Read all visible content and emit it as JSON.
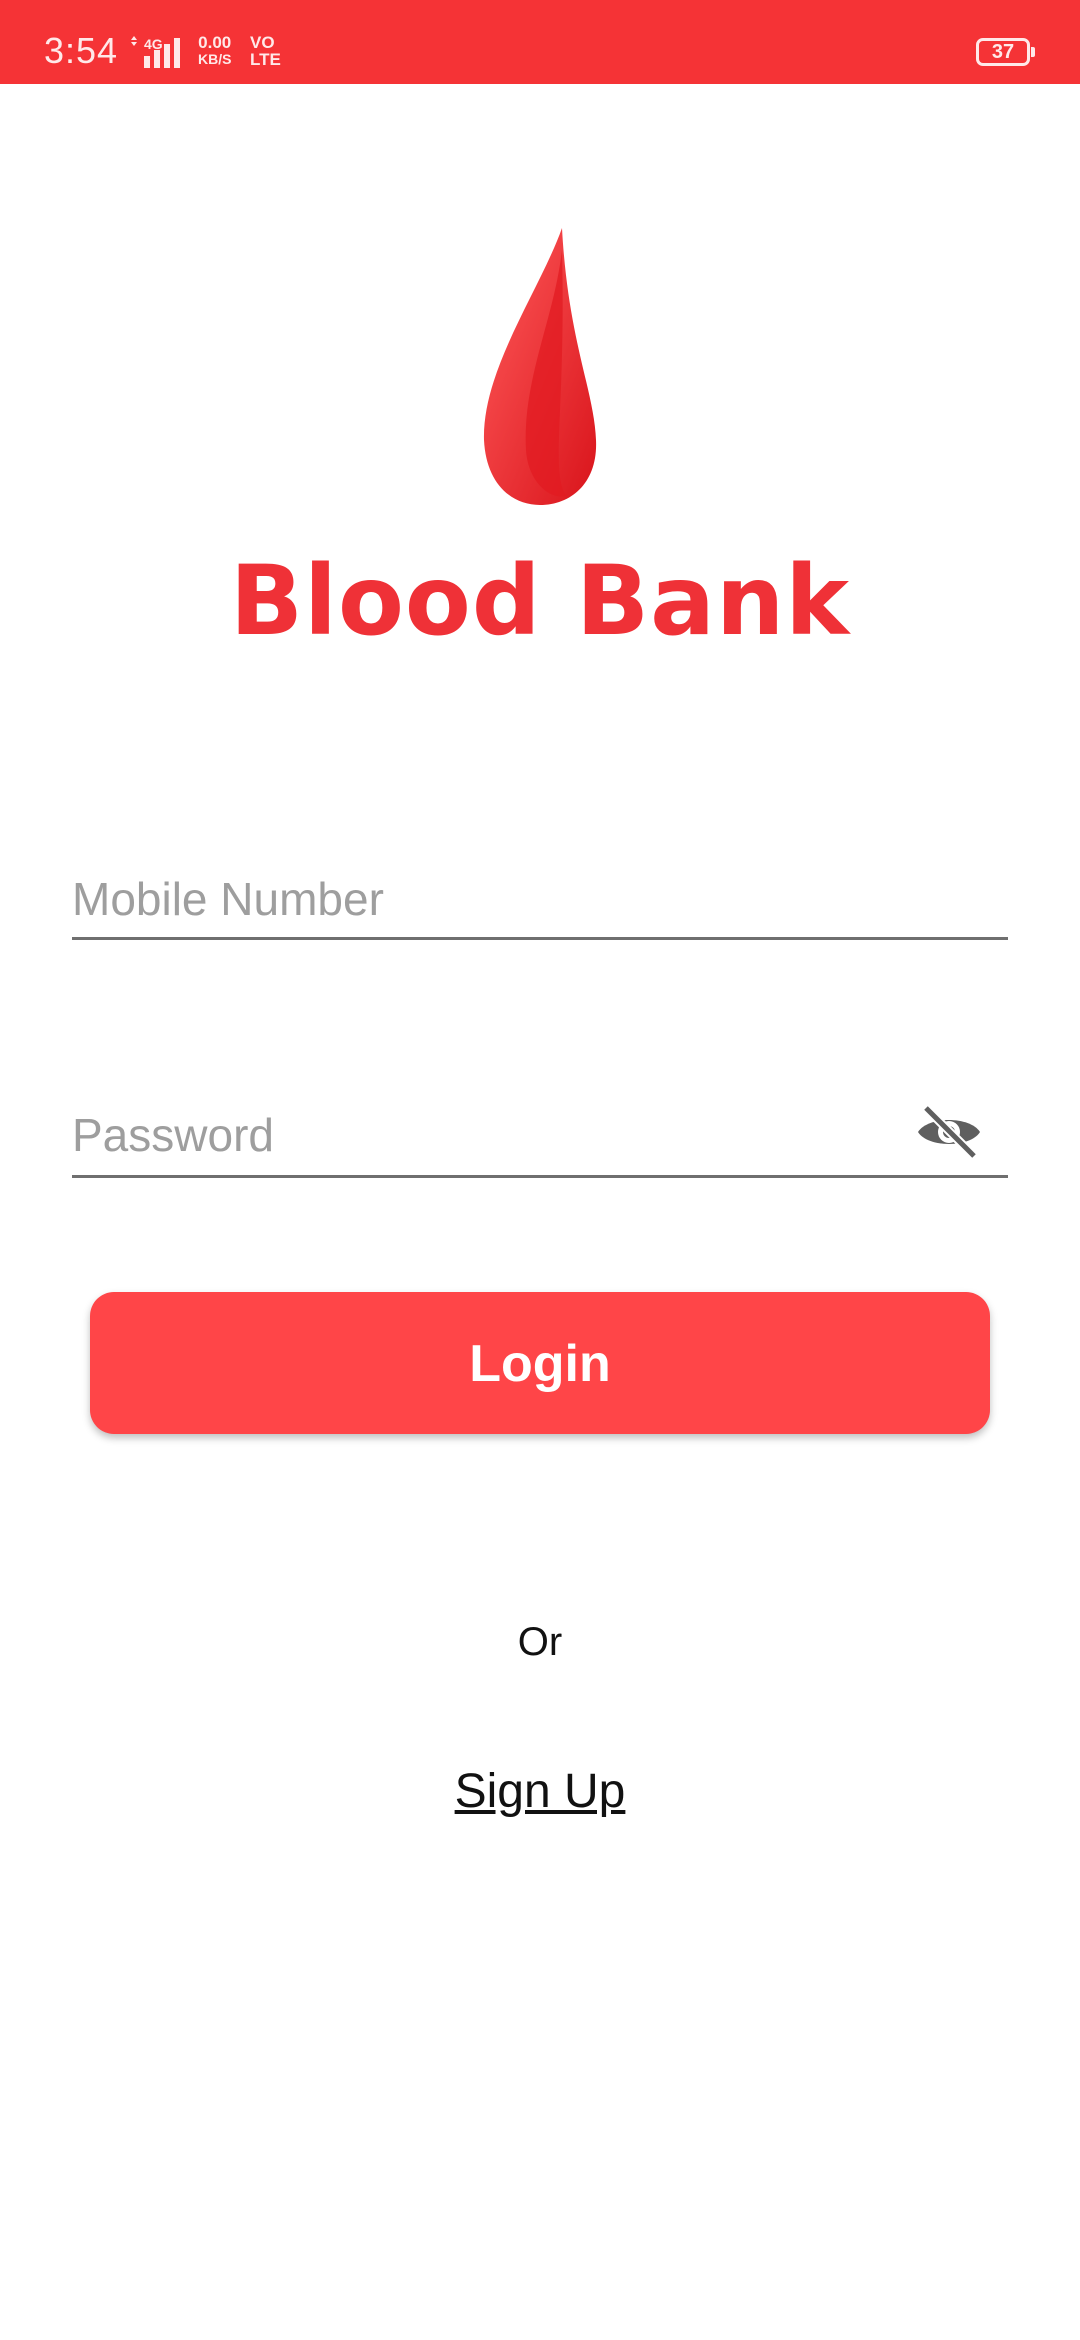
{
  "status_bar": {
    "time": "3:54",
    "network_type": "4G",
    "speed_value": "0.00",
    "speed_unit": "KB/S",
    "volte_top": "VO",
    "volte_bottom": "LTE",
    "battery": "37"
  },
  "brand": {
    "name": "Blood Bank",
    "color": "#ef3137"
  },
  "form": {
    "mobile_placeholder": "Mobile Number",
    "mobile_value": "",
    "password_placeholder": "Password",
    "password_value": "",
    "password_visibility_icon": "eye-off-icon"
  },
  "actions": {
    "login_label": "Login",
    "or_label": "Or",
    "signup_label": "Sign Up"
  },
  "colors": {
    "status_bar": "#f53336",
    "primary_button": "#ff4548"
  }
}
